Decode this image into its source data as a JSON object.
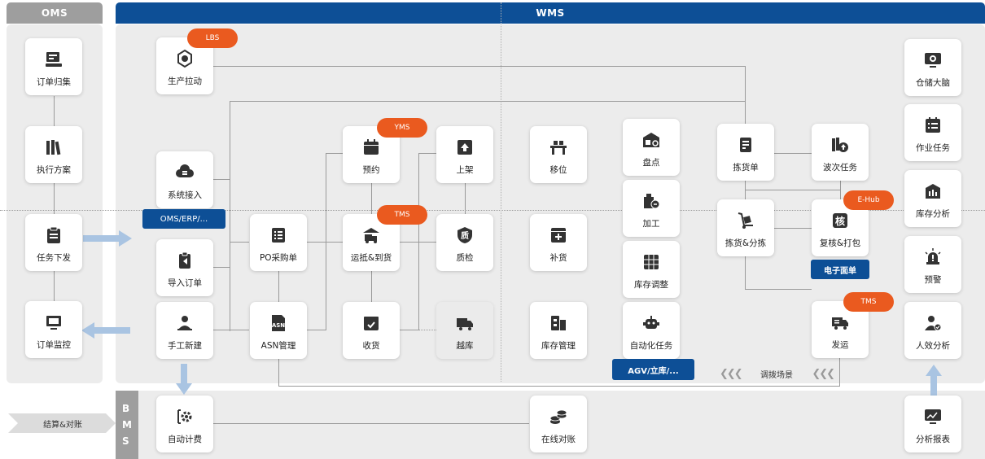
{
  "headers": {
    "oms": "OMS",
    "wms": "WMS",
    "bms": "BMS"
  },
  "oms_cards": [
    "订单归集",
    "执行方案",
    "任务下发",
    "订单监控"
  ],
  "bms_left_label": "结算&对账",
  "cards": {
    "production_pull": "生产拉动",
    "system_access": "系统接入",
    "import_order": "导入订单",
    "manual_create": "手工新建",
    "po_order": "PO采购单",
    "asn_manage": "ASN管理",
    "appointment": "预约",
    "shelve": "上架",
    "arrival": "运抵&到货",
    "quality": "质检",
    "receive": "收货",
    "cross_dock": "越库",
    "move": "移位",
    "replenish": "补货",
    "inventory_manage": "库存管理",
    "stocktake": "盘点",
    "process": "加工",
    "inventory_adjust": "库存调整",
    "automation_task": "自动化任务",
    "picking_order": "拣货单",
    "wave_task": "波次任务",
    "pick_sort": "拣货&分拣",
    "review_pack": "复核&打包",
    "ship": "发运",
    "warehouse_brain": "仓储大脑",
    "work_task": "作业任务",
    "inventory_analysis": "库存分析",
    "warning": "预警",
    "efficiency_analysis": "人效分析",
    "auto_billing": "自动计费",
    "online_reconcile": "在线对账",
    "analysis_report": "分析报表"
  },
  "pills": {
    "lbs": "LBS",
    "yms": "YMS",
    "tms1": "TMS",
    "tms2": "TMS",
    "ehub": "E-Hub"
  },
  "tags": {
    "oms_erp": "OMS/ERP/...",
    "e_waybill": "电子面单",
    "agv": "AGV/立库/..."
  },
  "transfer_scene": "调拨场景",
  "colors": {
    "header_blue": "#0d4f96",
    "pill_orange": "#ea5a1f",
    "panel_grey": "#ececec",
    "arrow_blue": "#a9c4e2"
  }
}
